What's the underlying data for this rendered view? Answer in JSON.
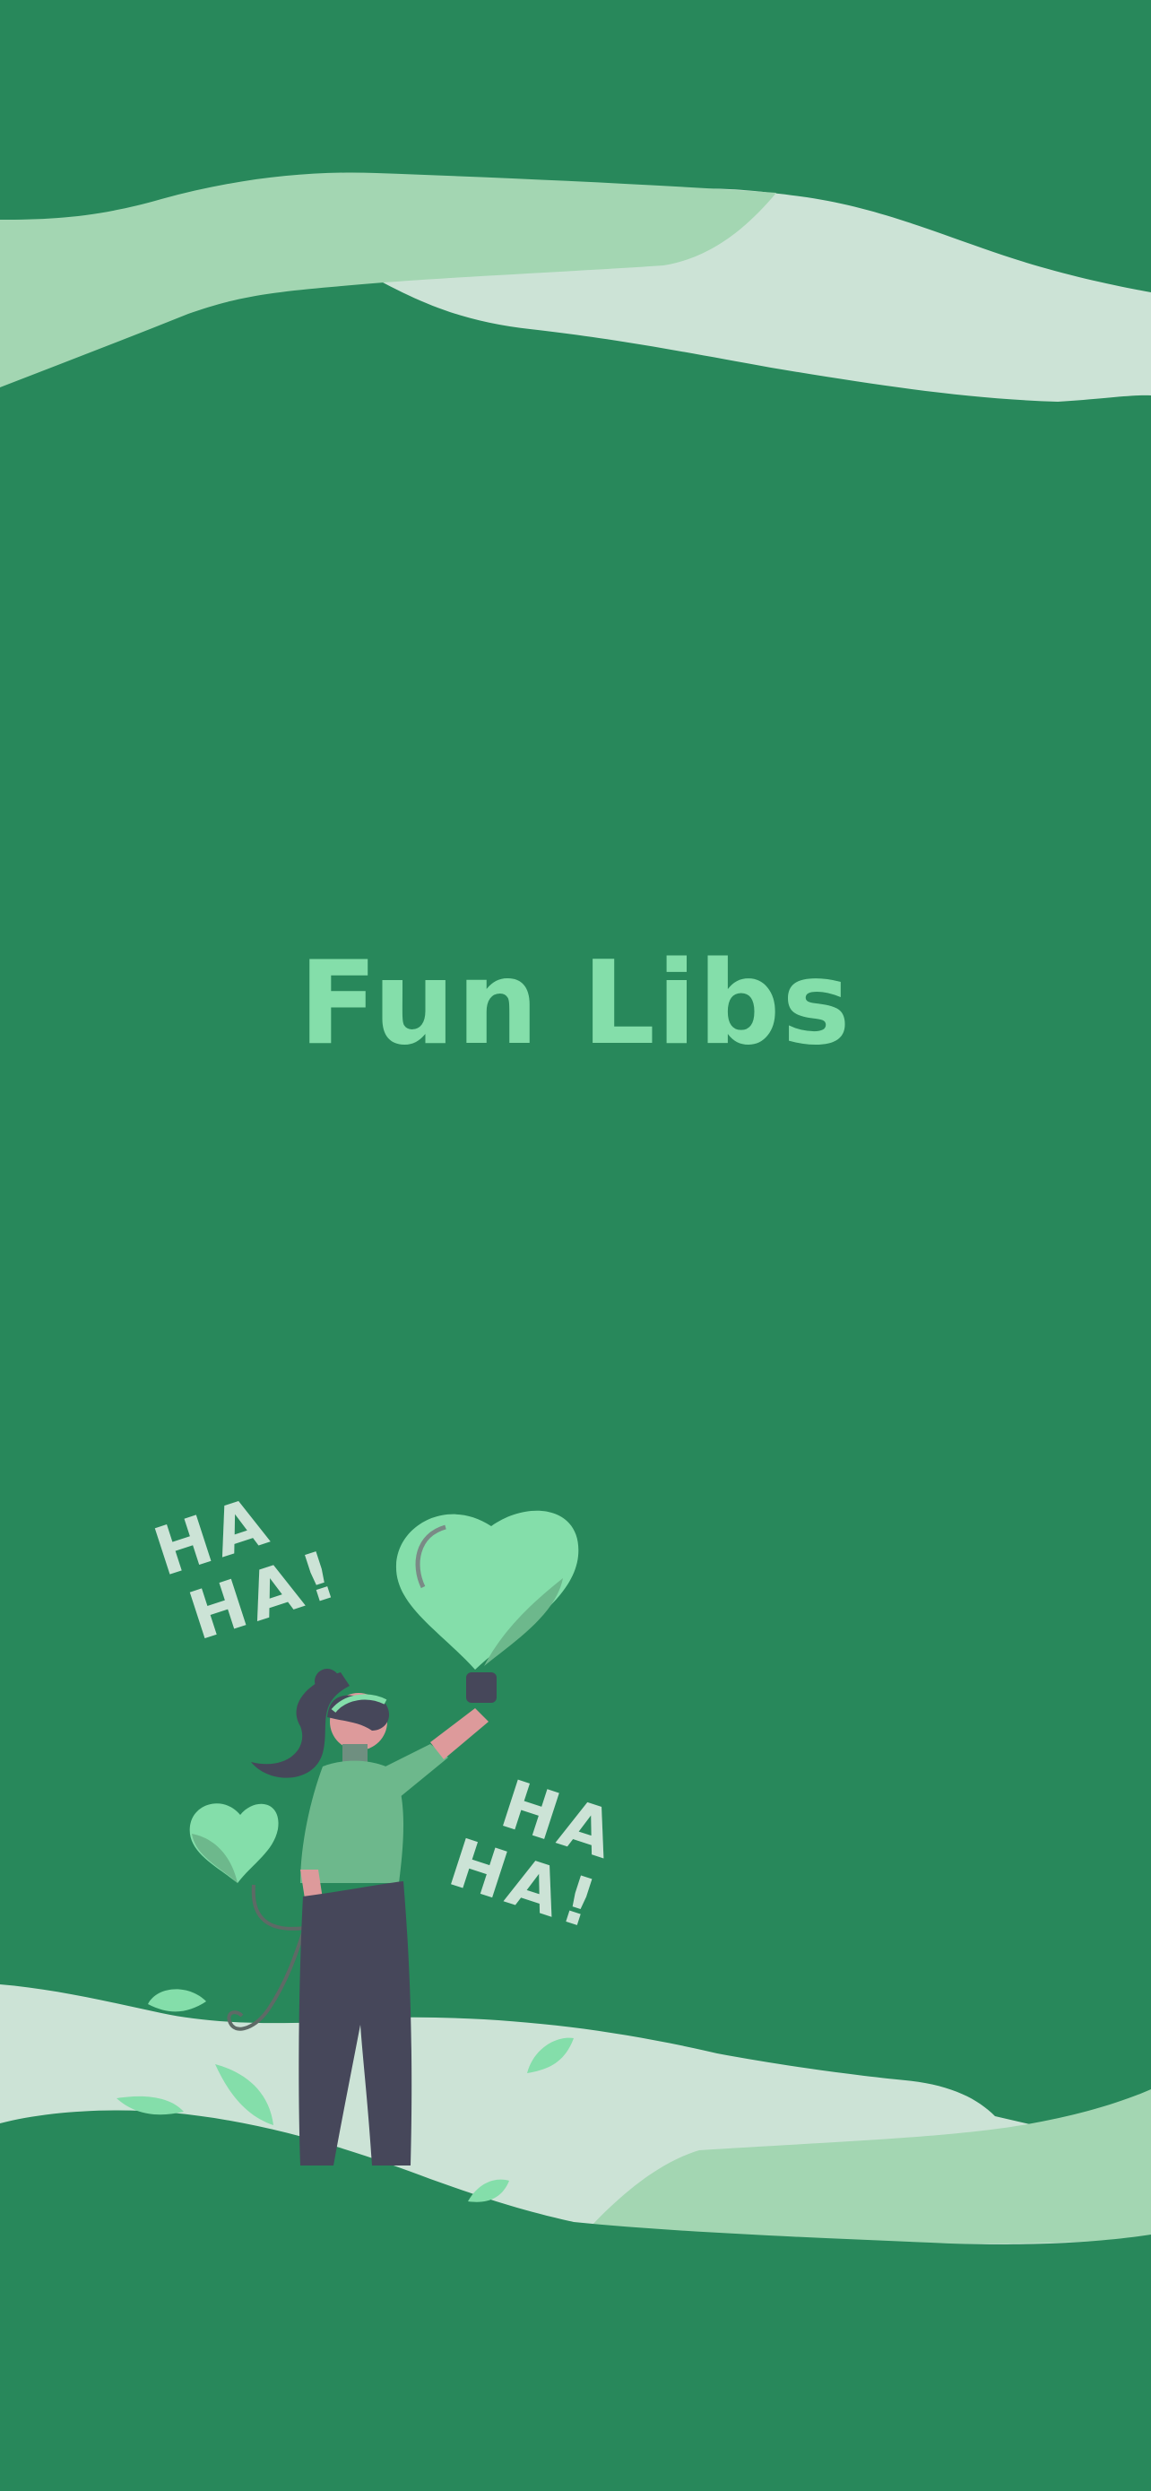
{
  "app": {
    "title": "Fun Libs"
  },
  "illustration": {
    "laugh_text_1_line1": "HA",
    "laugh_text_1_line2": "HA!",
    "laugh_text_2_line1": "HA",
    "laugh_text_2_line2": "HA!"
  },
  "colors": {
    "background": "#28885b",
    "title": "#84deaa",
    "wave_light": "#a3d6b2",
    "wave_pale": "#cce3d6",
    "accent_mint": "#84deaa",
    "figure_dark": "#46475a",
    "figure_shirt": "#6db88c",
    "figure_skin": "#dd9a9b"
  },
  "icons": {
    "heart_balloon_large": "heart-balloon-icon",
    "heart_balloon_small": "heart-balloon-icon",
    "leaf": "leaf-icon"
  }
}
